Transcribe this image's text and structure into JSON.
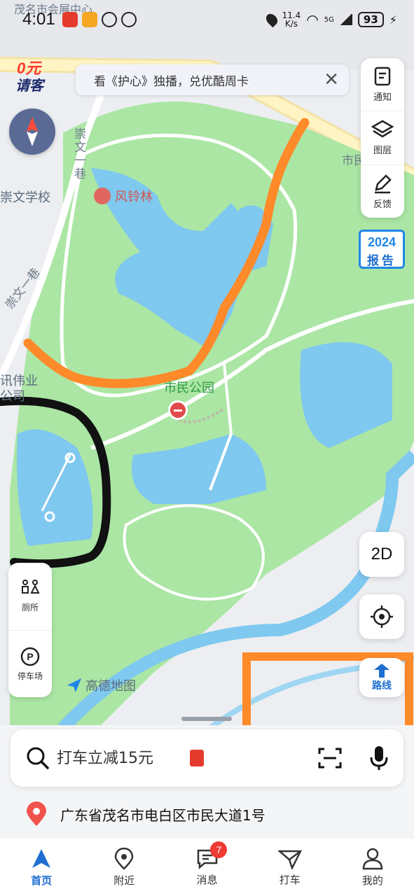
{
  "status_bar": {
    "time": "4:01",
    "net_speed_value": "11.4",
    "net_speed_unit": "K/s",
    "network": "5G",
    "battery": "93"
  },
  "promo": {
    "text": "看《护心》独播，兑优酷周卡",
    "badge_line1": "0元",
    "badge_line2": "请客"
  },
  "map": {
    "labels": {
      "park_name": "市民公园",
      "poi_fengling": "风铃林",
      "school": "崇文学校",
      "alley_top": "崇文一巷",
      "alley_bottom": "崇文一巷",
      "company_line1": "讯伟业",
      "company_line2": "公司",
      "road_top": "茂名市会展中心",
      "road_right": "市民"
    },
    "brand": "高德地图"
  },
  "tools": {
    "notify": "通知",
    "layers": "图层",
    "feedback": "反馈",
    "report_year": "2024",
    "report_label": "报告",
    "mode_2d": "2D",
    "route": "路线",
    "toilet": "厕所",
    "parking": "停车场"
  },
  "search": {
    "placeholder": "打车立减15元"
  },
  "address": "广东省茂名市电白区市民大道1号",
  "tabs": [
    {
      "label": "首页",
      "active": true
    },
    {
      "label": "附近"
    },
    {
      "label": "消息",
      "badge": "7"
    },
    {
      "label": "打车"
    },
    {
      "label": "我的"
    }
  ],
  "colors": {
    "accent": "#1f6fd0",
    "park": "#abe6a4",
    "water": "#7fc8ef",
    "annotation_orange": "#ff8a2a",
    "annotation_black": "#111111"
  }
}
